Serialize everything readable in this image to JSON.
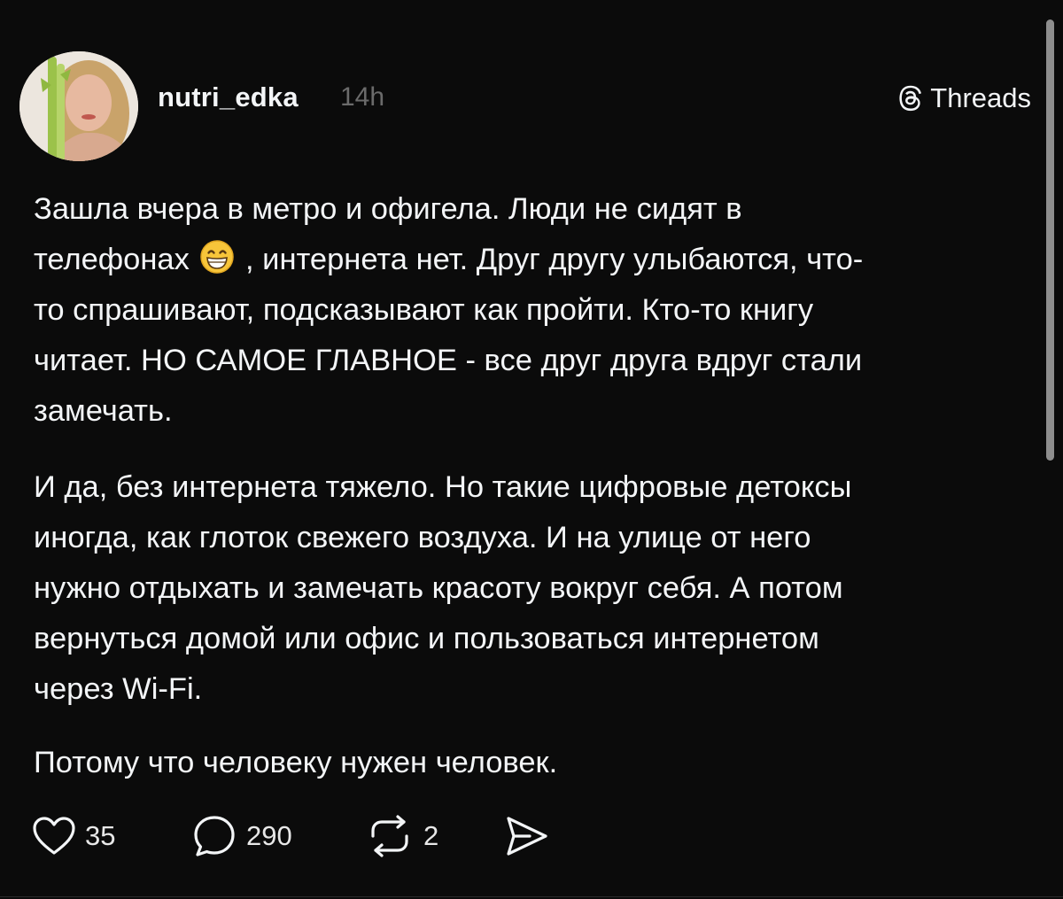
{
  "header": {
    "username": "nutri_edka",
    "timestamp": "14h",
    "brand_label": "Threads"
  },
  "post": {
    "p1_a": "Зашла вчера в метро и офигела. Люди не сидят в\nтелефонах ",
    "p1_b": " , интернета нет. Друг другу улыбаются, что-\nто спрашивают, подсказывают как пройти. Кто-то книгу\nчитает. НО САМОЕ ГЛАВНОЕ - все друг друга вдруг стали\nзамечать.",
    "p2": "И да, без интернета тяжело. Но такие цифровые детоксы\nиногда, как глоток свежего воздуха. И на улице от него\nнужно отдыхать и замечать красоту вокруг себя. А потом\nвернуться домой или офис и пользоваться интернетом\nчерез Wi-Fi.",
    "p3": "Потому что человеку нужен человек.",
    "emoji": "grinning-face-with-smiling-eyes"
  },
  "actions": {
    "likes": "35",
    "comments": "290",
    "reposts": "2"
  },
  "icons": {
    "like": "heart-icon",
    "comment": "comment-bubble-icon",
    "repost": "repost-icon",
    "share": "share-send-icon",
    "brand": "threads-logo-icon"
  },
  "colors": {
    "background": "#0b0b0b",
    "text": "#f3f5f7",
    "muted": "#6b6b6b"
  }
}
